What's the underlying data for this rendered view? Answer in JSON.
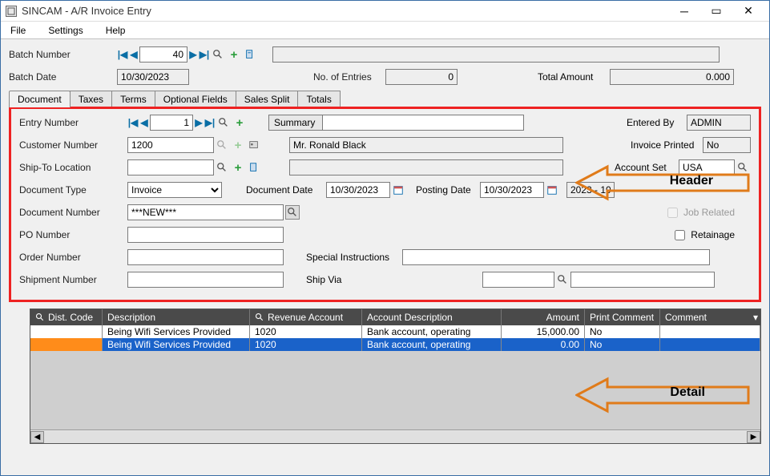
{
  "window": {
    "title": "SINCAM - A/R Invoice Entry"
  },
  "menu": {
    "file": "File",
    "settings": "Settings",
    "help": "Help"
  },
  "batch": {
    "number_label": "Batch Number",
    "number_value": "40",
    "date_label": "Batch Date",
    "date_value": "10/30/2023",
    "entries_label": "No. of Entries",
    "entries_value": "0",
    "total_label": "Total Amount",
    "total_value": "0.000",
    "desc_value": ""
  },
  "tabs": {
    "document": "Document",
    "taxes": "Taxes",
    "terms": "Terms",
    "optional": "Optional Fields",
    "sales": "Sales Split",
    "totals": "Totals"
  },
  "doc": {
    "entry_label": "Entry Number",
    "entry_value": "1",
    "summary_label": "Summary",
    "summary_value": "",
    "entered_by_label": "Entered By",
    "entered_by_value": "ADMIN",
    "customer_label": "Customer Number",
    "customer_value": "1200",
    "customer_name": "Mr. Ronald Black",
    "invoice_printed_label": "Invoice Printed",
    "invoice_printed_value": "No",
    "shipto_label": "Ship-To Location",
    "shipto_value": "",
    "account_set_label": "Account Set",
    "account_set_value": "USA",
    "doctype_label": "Document Type",
    "doctype_value": "Invoice",
    "docdate_label": "Document Date",
    "docdate_value": "10/30/2023",
    "postdate_label": "Posting Date",
    "postdate_value": "10/30/2023",
    "period_value": "2023 - 10",
    "docnum_label": "Document Number",
    "docnum_value": "***NEW***",
    "jobrelated_label": "Job Related",
    "ponum_label": "PO Number",
    "ponum_value": "",
    "retainage_label": "Retainage",
    "ordnum_label": "Order Number",
    "ordnum_value": "",
    "special_label": "Special Instructions",
    "special_value": "",
    "shipnum_label": "Shipment Number",
    "shipnum_value": "",
    "shipvia_label": "Ship Via",
    "shipvia_code": "",
    "shipvia_name": ""
  },
  "grid": {
    "col_dist": "Dist. Code",
    "col_desc": "Description",
    "col_rev": "Revenue Account",
    "col_accdesc": "Account Description",
    "col_amount": "Amount",
    "col_print": "Print Comment",
    "col_comment": "Comment",
    "rows": [
      {
        "dist": "",
        "desc": "Being Wifi Services Provided",
        "rev": "1020",
        "accdesc": "Bank account, operating",
        "amount": "15,000.00",
        "print": "No",
        "comment": ""
      },
      {
        "dist": "",
        "desc": "Being Wifi Services Provided",
        "rev": "1020",
        "accdesc": "Bank account, operating",
        "amount": "0.00",
        "print": "No",
        "comment": ""
      }
    ]
  },
  "annotations": {
    "header": "Header",
    "detail": "Detail"
  }
}
